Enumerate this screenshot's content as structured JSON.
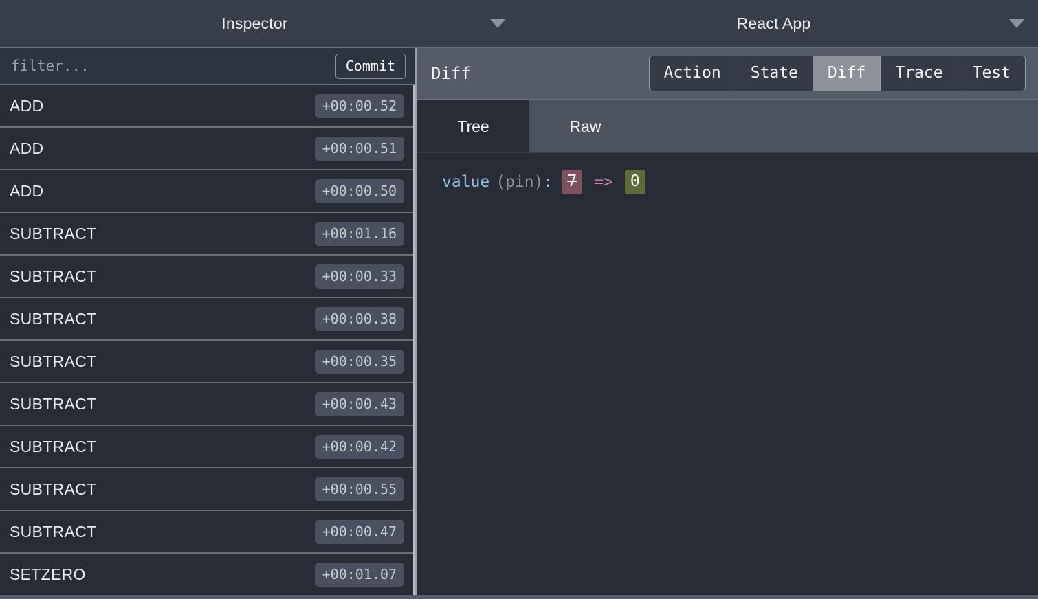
{
  "window": {
    "left_title": "Inspector",
    "right_title": "React App",
    "left_caret_icon": "chevron-down-icon",
    "right_caret_icon": "chevron-down-icon"
  },
  "left_pane": {
    "filter": {
      "value": "",
      "placeholder": "filter..."
    },
    "commit_label": "Commit",
    "columns": [
      "action",
      "time"
    ],
    "actions": [
      {
        "name": "ADD",
        "time": "+00:00.52"
      },
      {
        "name": "ADD",
        "time": "+00:00.51"
      },
      {
        "name": "ADD",
        "time": "+00:00.50"
      },
      {
        "name": "SUBTRACT",
        "time": "+00:01.16"
      },
      {
        "name": "SUBTRACT",
        "time": "+00:00.33"
      },
      {
        "name": "SUBTRACT",
        "time": "+00:00.38"
      },
      {
        "name": "SUBTRACT",
        "time": "+00:00.35"
      },
      {
        "name": "SUBTRACT",
        "time": "+00:00.43"
      },
      {
        "name": "SUBTRACT",
        "time": "+00:00.42"
      },
      {
        "name": "SUBTRACT",
        "time": "+00:00.55"
      },
      {
        "name": "SUBTRACT",
        "time": "+00:00.47"
      },
      {
        "name": "SETZERO",
        "time": "+00:01.07"
      }
    ]
  },
  "right_pane": {
    "inspector_label": "Diff",
    "tabs": [
      {
        "label": "Action",
        "active": false
      },
      {
        "label": "State",
        "active": false
      },
      {
        "label": "Diff",
        "active": true
      },
      {
        "label": "Trace",
        "active": false
      },
      {
        "label": "Test",
        "active": false
      }
    ],
    "subtabs": [
      {
        "label": "Tree",
        "active": true
      },
      {
        "label": "Raw",
        "active": false
      }
    ],
    "diff": {
      "key": "value",
      "pin": "(pin)",
      "colon": ":",
      "old_value": "7",
      "arrow": "=>",
      "new_value": "0"
    }
  },
  "colors": {
    "background": "#282c36",
    "header_bar": "#373d49",
    "panel_header": "#555b68",
    "subtab_inactive": "#4d525f",
    "divider": "#6b717c",
    "tab_active": "#8d9199",
    "tab_inactive": "#343a46",
    "time_badge": "#4a5060",
    "diff_removed": "#7d5260",
    "diff_added": "#5f6b3b",
    "diff_arrow": "#d77ab5",
    "diff_key": "#8fc0e0"
  }
}
